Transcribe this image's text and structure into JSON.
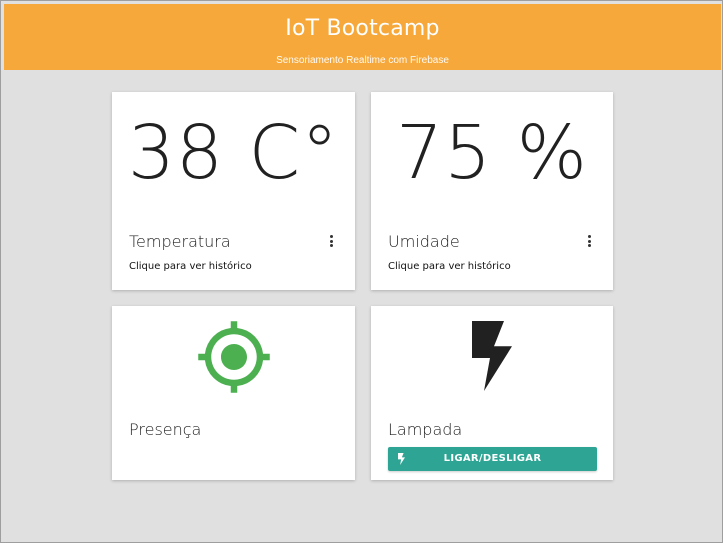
{
  "header": {
    "title": "IoT Bootcamp",
    "subtitle": "Sensoriamento Realtime com Firebase",
    "background_color": "#f6a83b"
  },
  "cards": {
    "temperature": {
      "value": "38 C°",
      "title": "Temperatura",
      "hint": "Clique para ver histórico",
      "menu_icon": "more-vert-icon"
    },
    "humidity": {
      "value": "75 %",
      "title": "Umidade",
      "hint": "Clique para ver histórico",
      "menu_icon": "more-vert-icon"
    },
    "presence": {
      "title": "Presença",
      "icon": "gps-fixed-icon",
      "icon_color": "#4caf50"
    },
    "lamp": {
      "title": "Lampada",
      "icon": "flash-on-icon",
      "button_label": "LIGAR/DESLIGAR",
      "button_color": "#2ea594"
    }
  }
}
